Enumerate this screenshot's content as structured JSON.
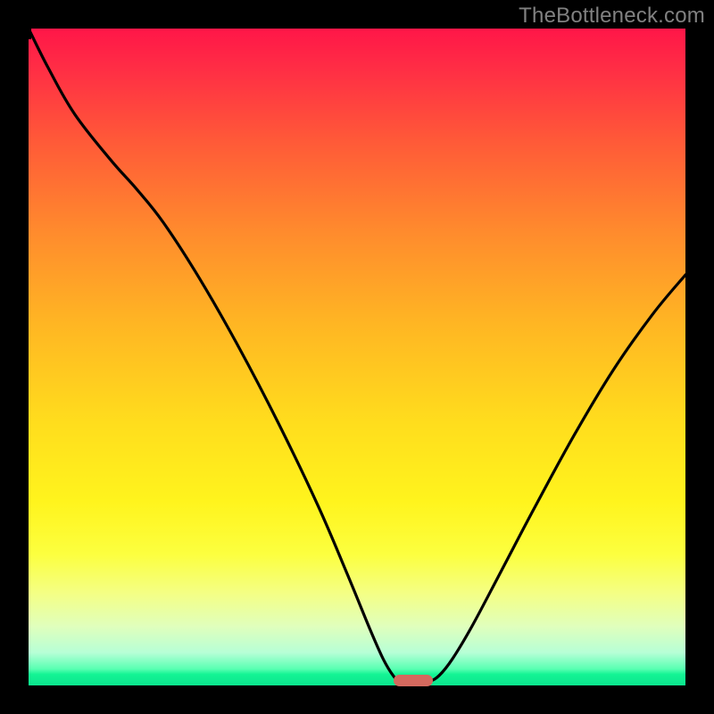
{
  "watermark": "TheBottleneck.com",
  "colors": {
    "curve": "#000000",
    "marker": "#d4695e",
    "frame_bg_top": "#ff1648",
    "frame_bg_bottom": "#0be58e"
  },
  "chart_data": {
    "type": "line",
    "title": "",
    "xlabel": "",
    "ylabel": "",
    "xlim": [
      0,
      100
    ],
    "ylim": [
      0,
      100
    ],
    "curve_points": [
      {
        "x": 0.0,
        "y": 100.0
      },
      {
        "x": 3.0,
        "y": 94.0
      },
      {
        "x": 7.0,
        "y": 87.0
      },
      {
        "x": 12.5,
        "y": 80.0
      },
      {
        "x": 16.5,
        "y": 75.5
      },
      {
        "x": 20.5,
        "y": 70.5
      },
      {
        "x": 26.0,
        "y": 62.0
      },
      {
        "x": 32.0,
        "y": 51.5
      },
      {
        "x": 38.0,
        "y": 40.0
      },
      {
        "x": 44.0,
        "y": 27.5
      },
      {
        "x": 48.5,
        "y": 17.0
      },
      {
        "x": 52.0,
        "y": 8.5
      },
      {
        "x": 54.0,
        "y": 4.0
      },
      {
        "x": 55.5,
        "y": 1.5
      },
      {
        "x": 56.5,
        "y": 0.6
      },
      {
        "x": 58.0,
        "y": 0.3
      },
      {
        "x": 59.5,
        "y": 0.3
      },
      {
        "x": 61.0,
        "y": 0.6
      },
      {
        "x": 62.5,
        "y": 1.5
      },
      {
        "x": 64.5,
        "y": 4.0
      },
      {
        "x": 67.5,
        "y": 9.0
      },
      {
        "x": 72.0,
        "y": 17.5
      },
      {
        "x": 77.0,
        "y": 27.0
      },
      {
        "x": 83.0,
        "y": 38.0
      },
      {
        "x": 89.0,
        "y": 48.0
      },
      {
        "x": 95.0,
        "y": 56.5
      },
      {
        "x": 100.0,
        "y": 62.5
      }
    ],
    "marker": {
      "x_center": 58.5,
      "y": 0.8,
      "width_pct": 6.0,
      "height_pct": 1.8
    }
  }
}
